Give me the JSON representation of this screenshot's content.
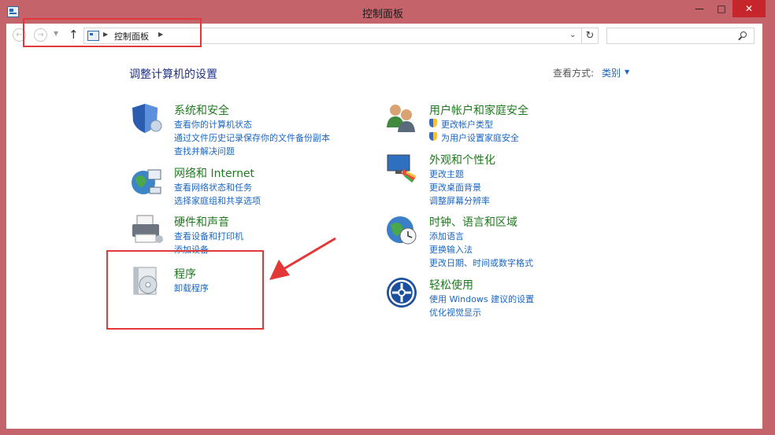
{
  "window": {
    "title": "控制面板",
    "minimize": "—",
    "maximize": "□",
    "close": "✕"
  },
  "nav": {
    "back": "←",
    "forward": "→",
    "up": "↑",
    "breadcrumb": "控制面板",
    "search_placeholder": ""
  },
  "header": {
    "title": "调整计算机的设置",
    "view_by_label": "查看方式:",
    "view_by_value": "类别"
  },
  "categories": [
    {
      "title": "系统和安全",
      "icon": "shield-icon",
      "links": [
        "查看你的计算机状态",
        "通过文件历史记录保存你的文件备份副本",
        "查找并解决问题"
      ]
    },
    {
      "title": "网络和 Internet",
      "icon": "network-globe-icon",
      "links": [
        "查看网络状态和任务",
        "选择家庭组和共享选项"
      ]
    },
    {
      "title": "硬件和声音",
      "icon": "printer-icon",
      "links": [
        "查看设备和打印机",
        "添加设备"
      ]
    },
    {
      "title": "程序",
      "icon": "programs-disc-icon",
      "links": [
        "卸载程序"
      ]
    },
    {
      "title": "用户帐户和家庭安全",
      "icon": "users-icon",
      "links": [
        "更改帐户类型",
        "为用户设置家庭安全"
      ]
    },
    {
      "title": "外观和个性化",
      "icon": "monitor-palette-icon",
      "links": [
        "更改主题",
        "更改桌面背景",
        "调整屏幕分辨率"
      ]
    },
    {
      "title": "时钟、语言和区域",
      "icon": "clock-globe-icon",
      "links": [
        "添加语言",
        "更换输入法",
        "更改日期、时间或数字格式"
      ]
    },
    {
      "title": "轻松使用",
      "icon": "ease-of-access-icon",
      "links": [
        "使用 Windows 建议的设置",
        "优化视觉显示"
      ]
    }
  ],
  "colors": {
    "desktop": "#c4636a",
    "heading": "#1e3287",
    "category_title": "#1f7a1f",
    "link": "#1a66c2",
    "highlight": "#e33838"
  }
}
